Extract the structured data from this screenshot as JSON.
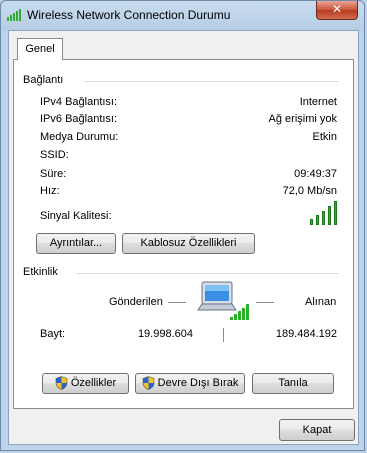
{
  "window": {
    "title": "Wireless Network Connection Durumu",
    "close_label": "✕"
  },
  "tabs": [
    {
      "label": "Genel"
    }
  ],
  "connection": {
    "section_title": "Bağlantı",
    "rows": [
      {
        "label": "IPv4 Bağlantısı:",
        "value": "Internet"
      },
      {
        "label": "IPv6 Bağlantısı:",
        "value": "Ağ erişimi yok"
      },
      {
        "label": "Medya Durumu:",
        "value": "Etkin"
      },
      {
        "label": "SSID:",
        "value": ""
      },
      {
        "label": "Süre:",
        "value": "09:49:37"
      },
      {
        "label": "Hız:",
        "value": "72,0 Mb/sn"
      }
    ],
    "signal_label": "Sinyal Kalitesi:",
    "signal_bars_active": 5,
    "details_button": "Ayrıntılar...",
    "wireless_props_button": "Kablosuz Özellikleri"
  },
  "activity": {
    "section_title": "Etkinlik",
    "sent_label": "Gönderilen",
    "received_label": "Alınan",
    "bytes_label": "Bayt:",
    "sent_value": "19.998.604",
    "received_value": "189.484.192",
    "properties_button": "Özellikler",
    "disable_button": "Devre Dışı Bırak",
    "diagnose_button": "Tanıla"
  },
  "footer": {
    "close_button": "Kapat"
  },
  "colors": {
    "signal_green": "#28b028",
    "shield_blue": "#2a62c9",
    "shield_yellow": "#f2c230"
  }
}
